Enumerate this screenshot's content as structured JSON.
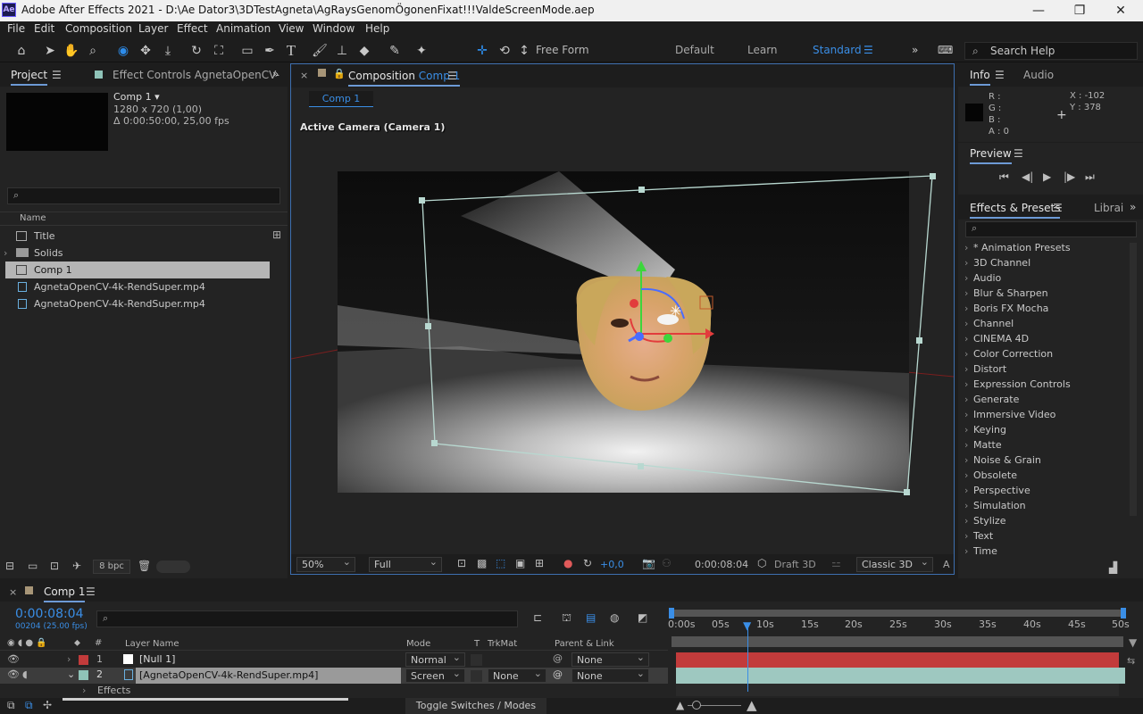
{
  "window": {
    "logo": "Ae",
    "title": "Adobe After Effects 2021 - D:\\Ae Dator3\\3DTestAgneta\\AgRaysGenomÖgonenFixat!!!ValdeScreenMode.aep",
    "min": "—",
    "restore": "❐",
    "close": "✕"
  },
  "menu": [
    "File",
    "Edit",
    "Composition",
    "Layer",
    "Effect",
    "Animation",
    "View",
    "Window",
    "Help"
  ],
  "toolbar": {
    "free_form": "Free Form",
    "workspaces": [
      "Default",
      "Learn",
      "Standard"
    ],
    "more": "»",
    "search_help_placeholder": "Search Help"
  },
  "project": {
    "tab_project": "Project",
    "tab_effect_controls": "Effect Controls  AgnetaOpenCV-",
    "comp_name": "Comp 1 ▾",
    "comp_size": "1280 x 720 (1,00)",
    "comp_duration": "Δ 0:00:50:00, 25,00 fps",
    "search_icon": "⌕",
    "col_name": "Name",
    "items": [
      "Title",
      "Solids",
      "Comp 1",
      "AgnetaOpenCV-4k-RendSuper.mp4",
      "AgnetaOpenCV-4k-RendSuper.mp4"
    ],
    "bpc": "8 bpc"
  },
  "composition": {
    "tab_label": "Composition",
    "tab_comp": "Comp 1",
    "breadcrumb": "Comp 1",
    "camera_label": "Active Camera (Camera 1)",
    "zoom": "50%",
    "resolution": "Full",
    "exposure": "+0,0",
    "timecode": "0:00:08:04",
    "renderer": "Draft 3D",
    "renderer_mode": "Classic 3D",
    "end_marker": "A"
  },
  "info": {
    "tab_info": "Info",
    "tab_audio": "Audio",
    "r": "R :",
    "g": "G :",
    "b": "B :",
    "a": "A :  0",
    "x": "X : -102",
    "y": "Y : 378"
  },
  "preview": {
    "title": "Preview",
    "controls": [
      "⏮",
      "◀|",
      "▶",
      "|▶",
      "⏭"
    ]
  },
  "effects": {
    "tab_effects": "Effects & Presets",
    "tab_libraries": "Librai",
    "items": [
      "* Animation Presets",
      "3D Channel",
      "Audio",
      "Blur & Sharpen",
      "Boris FX Mocha",
      "Channel",
      "CINEMA 4D",
      "Color Correction",
      "Distort",
      "Expression Controls",
      "Generate",
      "Immersive Video",
      "Keying",
      "Matte",
      "Noise & Grain",
      "Obsolete",
      "Perspective",
      "Simulation",
      "Stylize",
      "Text",
      "Time"
    ]
  },
  "timeline": {
    "tab": "Comp 1",
    "timecode": "0:00:08:04",
    "frames": "00204 (25.00 fps)",
    "col_hash": "#",
    "col_layer_name": "Layer Name",
    "col_mode": "Mode",
    "col_t": "T",
    "col_trkmat": "TrkMat",
    "col_parent": "Parent & Link",
    "layers": [
      {
        "num": "1",
        "name": "[Null 1]",
        "mode": "Normal",
        "trkmat": "",
        "parent": "None",
        "color": "#c23b3b"
      },
      {
        "num": "2",
        "name": "[AgnetaOpenCV-4k-RendSuper.mp4]",
        "mode": "Screen",
        "trkmat": "None",
        "parent": "None",
        "color": "#8fc3b8"
      }
    ],
    "effects_label": "Effects",
    "ruler": [
      "0:00s",
      "05s",
      "10s",
      "15s",
      "20s",
      "25s",
      "30s",
      "35s",
      "40s",
      "45s",
      "50s"
    ],
    "toggle_label": "Toggle Switches / Modes"
  }
}
